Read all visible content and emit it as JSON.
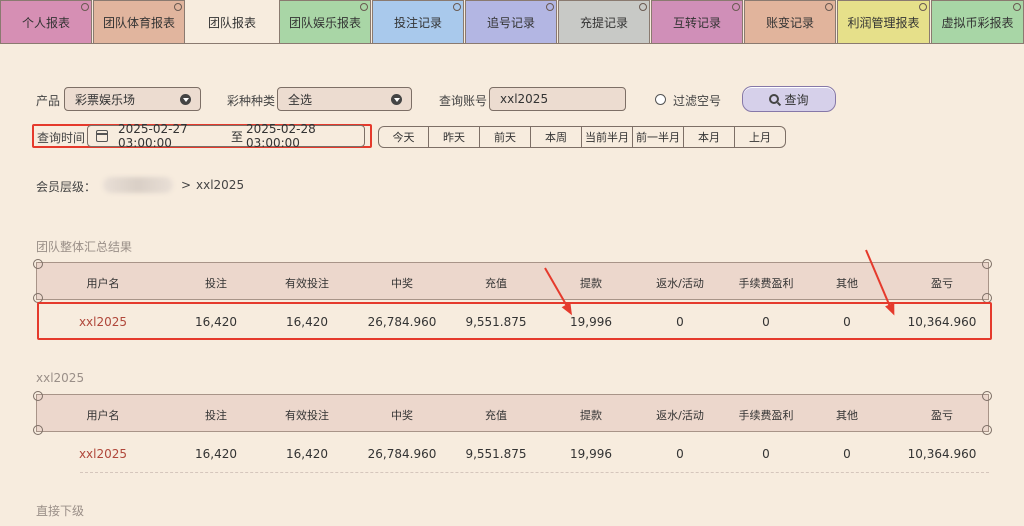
{
  "tabs": [
    {
      "label": "个人报表",
      "color": "#d68fb4"
    },
    {
      "label": "团队体育报表",
      "color": "#e1b59e"
    },
    {
      "label": "团队报表",
      "color": "#f7ecde",
      "active": true
    },
    {
      "label": "团队娱乐报表",
      "color": "#a9d6a6"
    },
    {
      "label": "投注记录",
      "color": "#a9c9ec"
    },
    {
      "label": "追号记录",
      "color": "#b3b6e3"
    },
    {
      "label": "充提记录",
      "color": "#c8c9c6"
    },
    {
      "label": "互转记录",
      "color": "#d08fb8"
    },
    {
      "label": "账变记录",
      "color": "#e1b49c"
    },
    {
      "label": "利润管理报表",
      "color": "#e6e08a"
    },
    {
      "label": "虚拟币彩报表",
      "color": "#a8d6a6"
    }
  ],
  "filters": {
    "product_label": "产品",
    "product_value": "彩票娱乐场",
    "lottery_type_label": "彩种种类",
    "lottery_type_value": "全选",
    "account_label": "查询账号",
    "account_value": "xxl2025",
    "filter_empty_label": "过滤空号",
    "query_button": "查询",
    "time_label": "查询时间",
    "date_start": "2025-02-27 03:00:00",
    "date_separator": "至",
    "date_end": "2025-02-28 03:00:00",
    "quick_dates": [
      "今天",
      "昨天",
      "前天",
      "本周",
      "当前半月",
      "前一半月",
      "本月",
      "上月"
    ]
  },
  "member_level": {
    "label": "会员层级：",
    "separator": ">",
    "value": "xxl2025"
  },
  "columns": [
    "用户名",
    "投注",
    "有效投注",
    "中奖",
    "充值",
    "提款",
    "返水/活动",
    "手续费盈利",
    "其他",
    "盈亏"
  ],
  "summary_table": {
    "title": "团队整体汇总结果",
    "rows": [
      [
        "xxl2025",
        "16,420",
        "16,420",
        "26,784.960",
        "9,551.875",
        "19,996",
        "0",
        "0",
        "0",
        "10,364.960"
      ]
    ]
  },
  "user_table": {
    "title": "xxl2025",
    "rows": [
      [
        "xxl2025",
        "16,420",
        "16,420",
        "26,784.960",
        "9,551.875",
        "19,996",
        "0",
        "0",
        "0",
        "10,364.960"
      ]
    ]
  },
  "direct_subordinates": {
    "title": "直接下级"
  },
  "colors": {
    "highlight": "#e53a2c",
    "background": "#f7ecde",
    "header": "#ecd7cc",
    "username": "#b0473a"
  }
}
